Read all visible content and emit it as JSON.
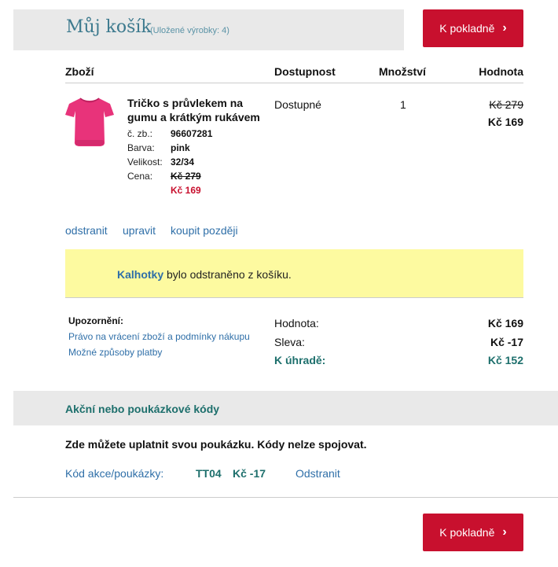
{
  "cart": {
    "title": "Můj košík",
    "subtitle": "(Uložené výrobky: 4)",
    "checkout_label": "K pokladně"
  },
  "table": {
    "col_product": "Zboží",
    "col_availability": "Dostupnost",
    "col_quantity": "Množství",
    "col_value": "Hodnota"
  },
  "item": {
    "name": "Tričko s průvlekem na gumu a krátkým rukávem",
    "sku_label": "č. zb.:",
    "sku": "96607281",
    "color_label": "Barva:",
    "color": "pink",
    "size_label": "Velikost:",
    "size": "32/34",
    "price_label": "Cena:",
    "price_old": "Kč 279",
    "price_new": "Kč 169",
    "availability": "Dostupné",
    "quantity": "1",
    "value_old": "Kč 279",
    "value_new": "Kč 169",
    "image_color": "#e8337a",
    "actions": {
      "remove": "odstranit",
      "edit": "upravit",
      "later": "koupit později"
    }
  },
  "notice": {
    "product": "Kalhotky",
    "text": " bylo odstraněno z košíku."
  },
  "warnings": {
    "title": "Upozornění:",
    "link_returns": "Právo na vrácení zboží a podmínky nákupu",
    "link_payment": "Možné způsoby platby"
  },
  "summary": {
    "value_label": "Hodnota:",
    "value": "Kč 169",
    "discount_label": "Sleva:",
    "discount": "Kč -17",
    "total_label": "K úhradě:",
    "total": "Kč 152"
  },
  "codes": {
    "title": "Akční nebo poukázkové kódy",
    "intro": "Zde můžete uplatnit svou poukázku. Kódy nelze spojovat.",
    "label": "Kód akce/poukázky:",
    "code": "TT04",
    "amount": "Kč -17",
    "remove": "Odstranit"
  },
  "colors": {
    "accent_red": "#c8102e",
    "teal": "#1d6f6c",
    "link_blue": "#2f6fa8",
    "notice_yellow": "#fdfaa0"
  }
}
